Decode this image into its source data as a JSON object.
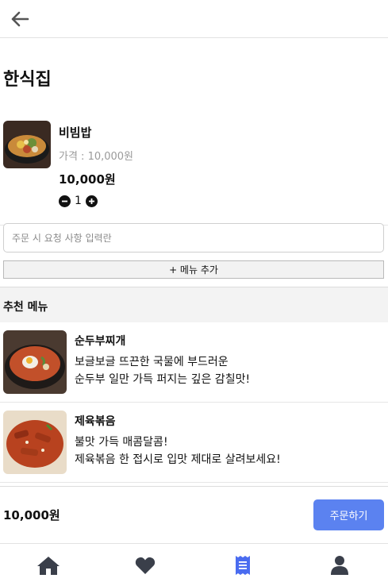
{
  "header": {
    "back_icon": "arrow-left-icon"
  },
  "store": {
    "title": "한식집"
  },
  "cart": {
    "item_name": "비빔밥",
    "price_label": "가격 : 10,000원",
    "item_total": "10,000원",
    "quantity": "1"
  },
  "request": {
    "placeholder": "주문 시 요청 사항 입력란",
    "value": ""
  },
  "add_menu": {
    "label": "+ 메뉴 추가"
  },
  "recommend": {
    "title": "추천 메뉴",
    "items": [
      {
        "name": "순두부찌개",
        "desc_line1": "보글보글 뜨끈한 국물에 부드러운",
        "desc_line2": "순두부 일만 가득 퍼지는 깊은 감칠맛!"
      },
      {
        "name": "제육볶음",
        "desc_line1": "불맛 가득 매콤달콤!",
        "desc_line2": "제육볶음 한 접시로 입맛 제대로 살려보세요!"
      }
    ]
  },
  "order": {
    "total": "10,000원",
    "button_label": "주문하기"
  },
  "tabbar": {
    "items": [
      {
        "icon": "home-icon"
      },
      {
        "icon": "heart-icon"
      },
      {
        "icon": "receipt-icon",
        "active": true
      },
      {
        "icon": "user-icon"
      }
    ]
  },
  "colors": {
    "accent": "#5b82f0",
    "active_tab": "#4a6cf0",
    "inactive_tab": "#3a3f4a"
  }
}
